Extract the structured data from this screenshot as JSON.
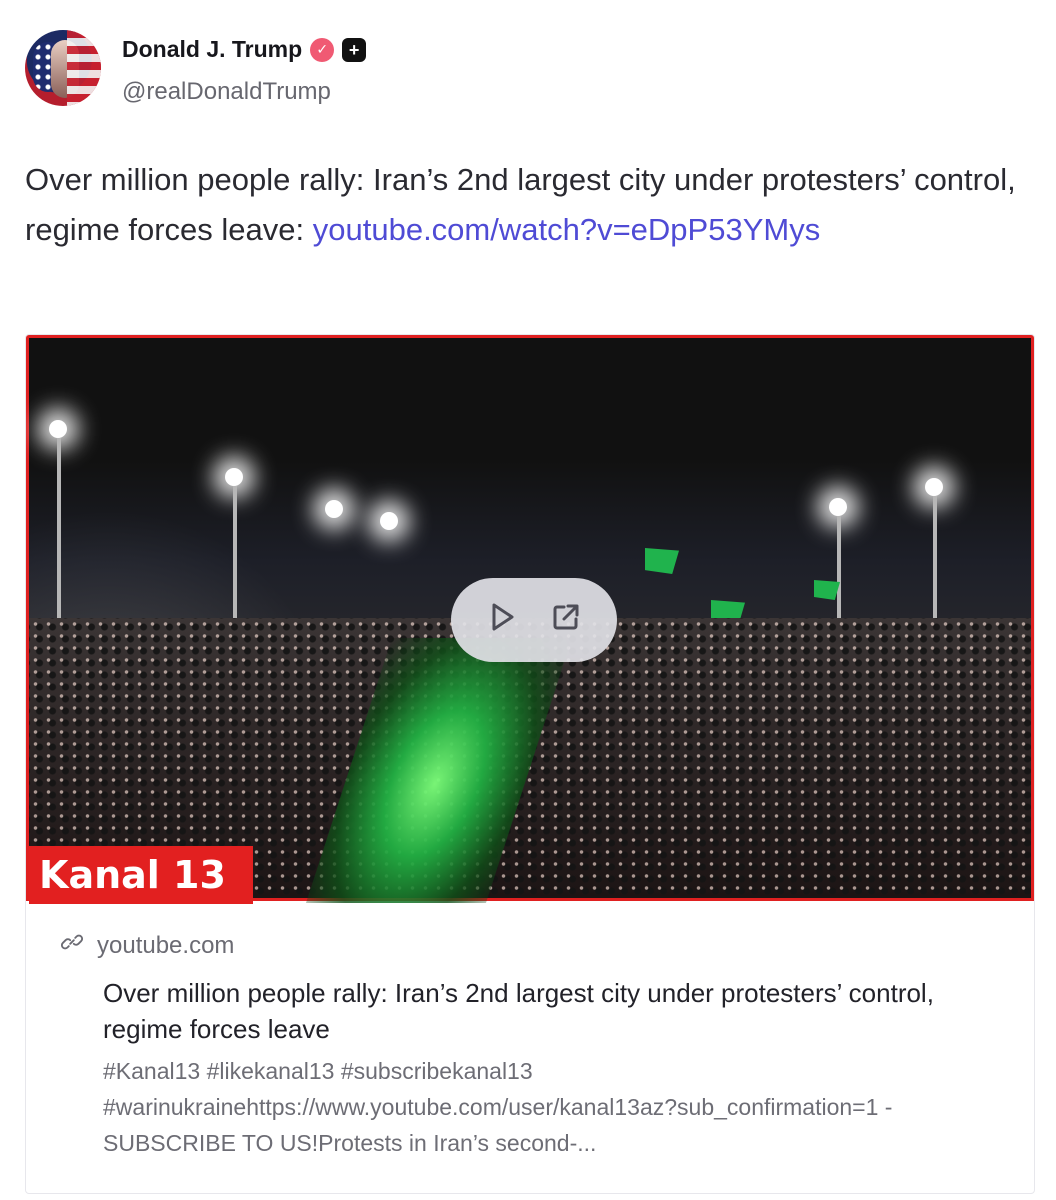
{
  "profile": {
    "display_name": "Donald J. Trump",
    "handle": "@realDonaldTrump",
    "verified_badge_icon": "verified-badge-icon",
    "plus_icon": "plus-icon"
  },
  "post": {
    "text_prefix": "Over million people rally: Iran’s 2nd largest city under protesters’ control, regime forces leave:",
    "link_text": "youtube.com/watch?v=eDpP53YMys"
  },
  "link_card": {
    "image_caption_badge": "Kanal 13",
    "source_domain": "youtube.com",
    "title": "Over million people rally: Iran’s 2nd largest city under protesters’ control, regime forces leave",
    "description": "#Kanal13 #likekanal13 #subscribekanal13 #warinukrainehttps://www.youtube.com/user/kanal13az?sub_confirmation=1 - SUBSCRIBE TO US!Protests in Iran’s second-...",
    "controls": {
      "play_icon": "play-icon",
      "open_external_icon": "open-external-icon",
      "link_icon": "link-icon"
    }
  }
}
